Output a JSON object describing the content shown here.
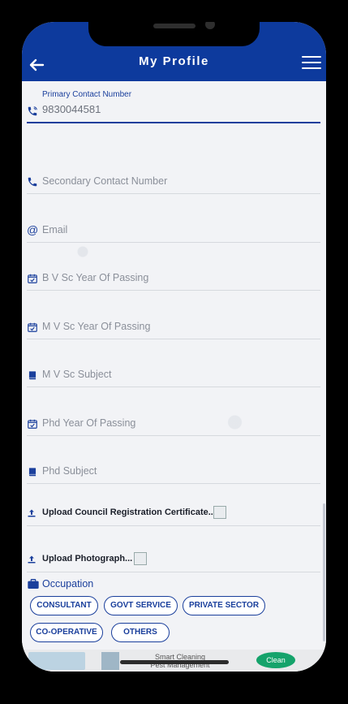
{
  "header": {
    "title": "My Profile"
  },
  "form": {
    "primary_contact_label": "Primary Contact Number",
    "primary_contact_value": "9830044581",
    "secondary_contact_placeholder": "Secondary Contact Number",
    "email_placeholder": "Email",
    "bvsc_year_placeholder": "B V Sc Year Of Passing",
    "mvsc_year_placeholder": "M V Sc Year Of Passing",
    "mvsc_subject_placeholder": "M V Sc Subject",
    "phd_year_placeholder": "Phd Year Of Passing",
    "phd_subject_placeholder": "Phd Subject",
    "upload_council_label": "Upload Council Registration Certificate...",
    "upload_photo_label": "Upload Photograph..."
  },
  "occupation": {
    "label": "Occupation",
    "options": [
      "CONSULTANT",
      "GOVT SERVICE",
      "PRIVATE SECTOR",
      "CO-OPERATIVE",
      "OTHERS"
    ]
  },
  "banner": {
    "text_line1": "Smart Cleaning",
    "text_line2": "Pest Management",
    "logo_text": "Clean"
  }
}
